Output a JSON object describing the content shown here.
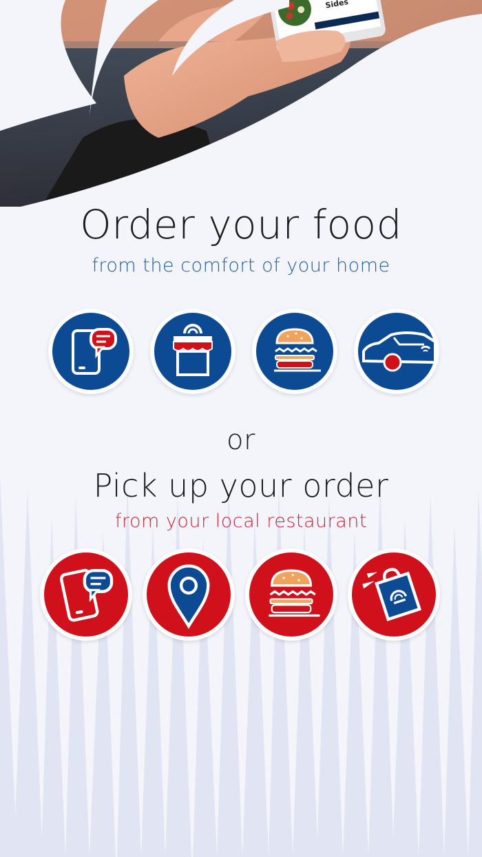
{
  "hero": {
    "phone_screen_label": "Sides"
  },
  "delivery": {
    "title": "Order your food",
    "subtitle": "from the comfort of your home",
    "icons": [
      "phone-chat-icon",
      "storefront-icon",
      "burger-icon",
      "car-icon"
    ]
  },
  "separator": "or",
  "pickup": {
    "title": "Pick up your order",
    "subtitle": "from your local restaurant",
    "icons": [
      "phone-chat-icon",
      "location-pin-icon",
      "burger-icon",
      "shopping-bag-icon"
    ]
  },
  "colors": {
    "blue": "#0d4a94",
    "red": "#d0111b",
    "background": "#f4f5fb",
    "subtitle_blue": "#1d5c9e",
    "subtitle_red": "#d32231"
  }
}
